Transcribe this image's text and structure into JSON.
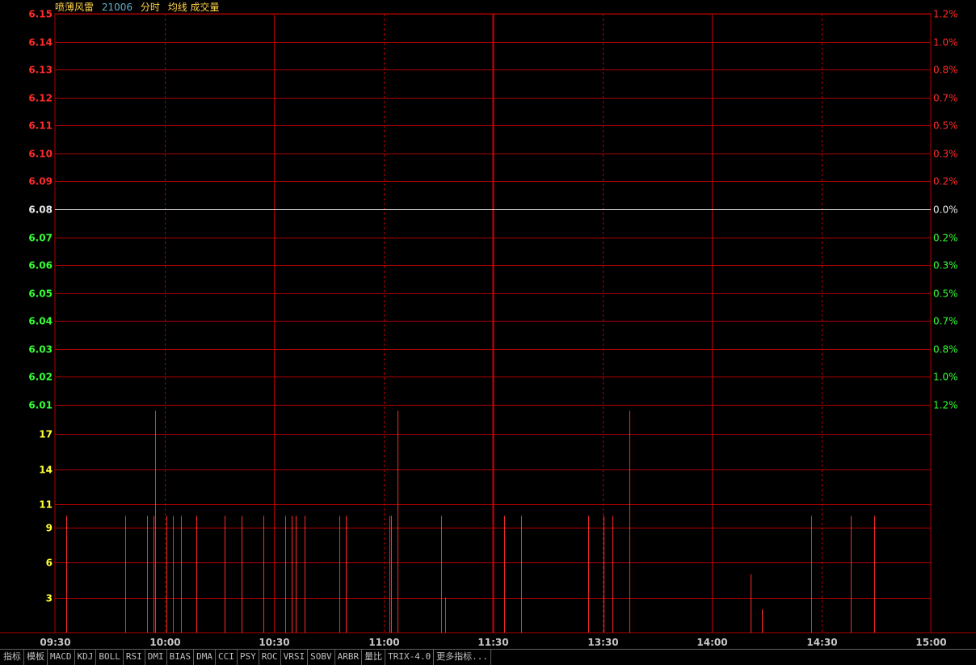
{
  "header": {
    "stock_name": "喷薄风雷",
    "code": "21006",
    "mode": "分时",
    "indicators": "均线 成交量"
  },
  "colors": {
    "up": "#ff2a2a",
    "down": "#33ff33",
    "flat": "#e8e8e8",
    "grid": "#b00000",
    "vol_tick": "#ffff33",
    "time_tick": "#c8c8c8",
    "name": "#ffd24a",
    "code": "#60b0d0",
    "header_text": "#ffd24a"
  },
  "chart_data": [
    {
      "type": "line",
      "panel": "price",
      "prev_close": 6.08,
      "ylim": [
        6.01,
        6.15
      ],
      "y_ticks": [
        {
          "value": 6.15,
          "label": "6.15",
          "pct": "1.2%",
          "trend": "up"
        },
        {
          "value": 6.14,
          "label": "6.14",
          "pct": "1.0%",
          "trend": "up"
        },
        {
          "value": 6.13,
          "label": "6.13",
          "pct": "0.8%",
          "trend": "up"
        },
        {
          "value": 6.12,
          "label": "6.12",
          "pct": "0.7%",
          "trend": "up"
        },
        {
          "value": 6.11,
          "label": "6.11",
          "pct": "0.5%",
          "trend": "up"
        },
        {
          "value": 6.1,
          "label": "6.10",
          "pct": "0.3%",
          "trend": "up"
        },
        {
          "value": 6.09,
          "label": "6.09",
          "pct": "0.2%",
          "trend": "up"
        },
        {
          "value": 6.08,
          "label": "6.08",
          "pct": "0.0%",
          "trend": "flat"
        },
        {
          "value": 6.07,
          "label": "6.07",
          "pct": "0.2%",
          "trend": "down"
        },
        {
          "value": 6.06,
          "label": "6.06",
          "pct": "0.3%",
          "trend": "down"
        },
        {
          "value": 6.05,
          "label": "6.05",
          "pct": "0.5%",
          "trend": "down"
        },
        {
          "value": 6.04,
          "label": "6.04",
          "pct": "0.7%",
          "trend": "down"
        },
        {
          "value": 6.03,
          "label": "6.03",
          "pct": "0.8%",
          "trend": "down"
        },
        {
          "value": 6.02,
          "label": "6.02",
          "pct": "1.0%",
          "trend": "down"
        },
        {
          "value": 6.01,
          "label": "6.01",
          "pct": "1.2%",
          "trend": "down"
        }
      ],
      "series": [
        {
          "values": [
            6.08,
            6.08
          ]
        }
      ]
    },
    {
      "type": "bar",
      "panel": "volume",
      "ylim": [
        0,
        19.5
      ],
      "y_ticks": [
        {
          "value": 17,
          "label": "17"
        },
        {
          "value": 14,
          "label": "14"
        },
        {
          "value": 11,
          "label": "11"
        },
        {
          "value": 9,
          "label": "9"
        },
        {
          "value": 6,
          "label": "6"
        },
        {
          "value": 3,
          "label": "3"
        }
      ],
      "x_minutes": [
        2,
        29,
        39,
        42,
        48,
        51,
        55,
        62,
        75,
        83,
        93,
        103,
        106,
        108,
        112,
        128,
        131,
        151,
        152,
        175,
        177,
        204,
        212,
        243,
        250,
        254,
        318,
        323,
        346,
        364,
        375
      ],
      "values": [
        10,
        10,
        10,
        10,
        10,
        10,
        10,
        10,
        10,
        10,
        10,
        10,
        10,
        10,
        10,
        10,
        10,
        10,
        10,
        10,
        3,
        10,
        10,
        10,
        10,
        10,
        5,
        2,
        10,
        10,
        10
      ],
      "peaks_minutes": [
        43,
        155,
        262
      ],
      "peaks_values": [
        19,
        19,
        19
      ],
      "x_ticks": [
        {
          "minute": 0,
          "label": "09:30"
        },
        {
          "minute": 30,
          "label": "10:00"
        },
        {
          "minute": 60,
          "label": "10:30"
        },
        {
          "minute": 90,
          "label": "11:00"
        },
        {
          "minute": 120,
          "label": "11:30"
        },
        {
          "minute": 150,
          "label": "13:30"
        },
        {
          "minute": 180,
          "label": "14:00"
        },
        {
          "minute": 210,
          "label": "14:30"
        },
        {
          "minute": 240,
          "label": "15:00"
        }
      ],
      "x_range_minutes": [
        0,
        240
      ]
    }
  ],
  "tabs": [
    "指标",
    "模板",
    "MACD",
    "KDJ",
    "BOLL",
    "RSI",
    "DMI",
    "BIAS",
    "DMA",
    "CCI",
    "PSY",
    "ROC",
    "VRSI",
    "SOBV",
    "ARBR",
    "量比",
    "TRIX-4.0",
    "更多指标..."
  ]
}
